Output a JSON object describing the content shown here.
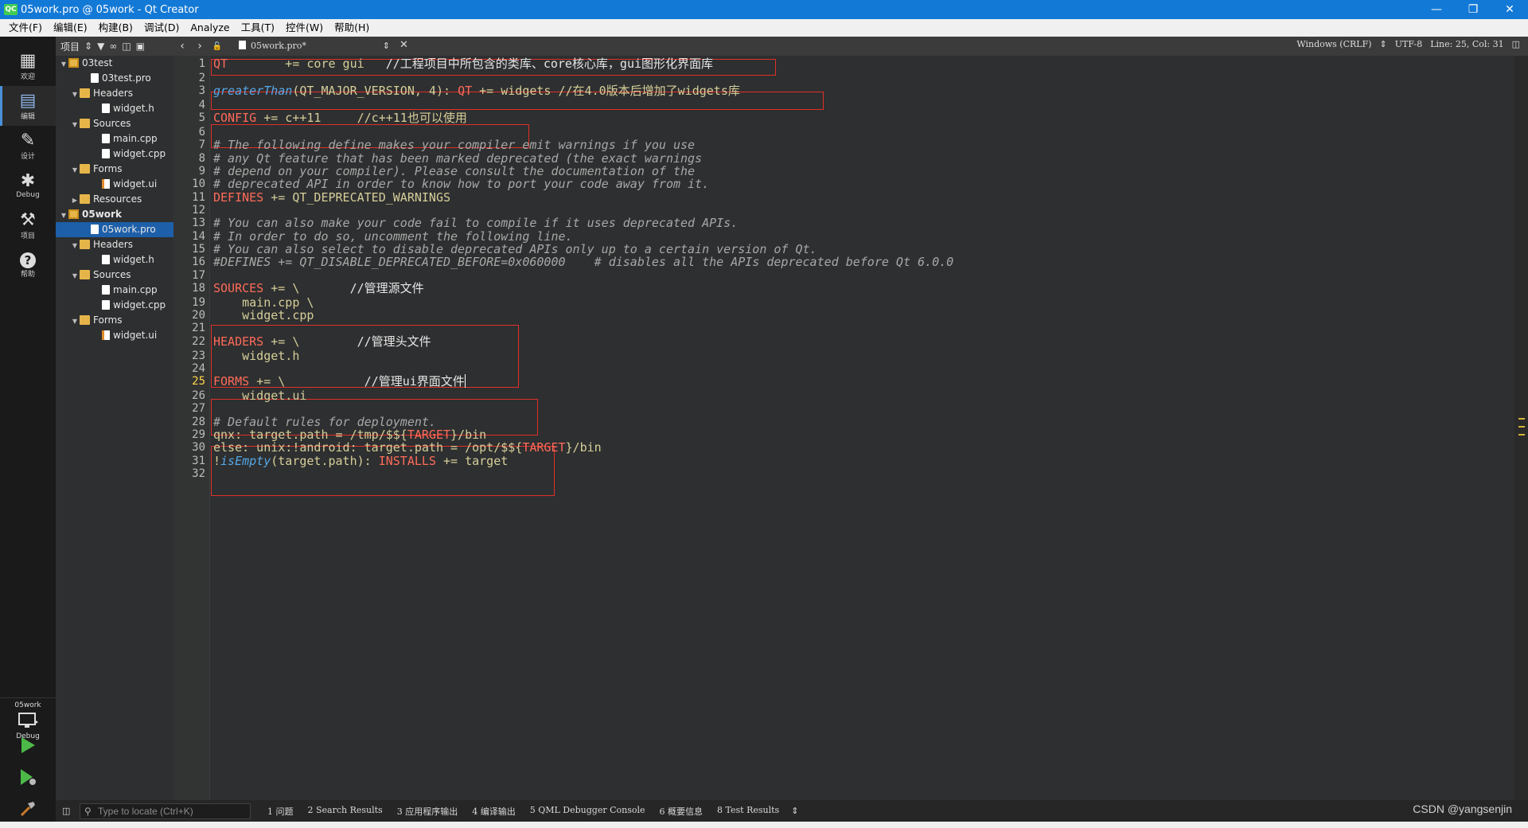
{
  "window": {
    "title": "05work.pro @ 05work - Qt Creator",
    "app_icon": "QC"
  },
  "menu": [
    "文件(F)",
    "编辑(E)",
    "构建(B)",
    "调试(D)",
    "Analyze",
    "工具(T)",
    "控件(W)",
    "帮助(H)"
  ],
  "modes": [
    {
      "label": "欢迎",
      "icon": "grid-icon"
    },
    {
      "label": "编辑",
      "icon": "edit-doc-icon"
    },
    {
      "label": "设计",
      "icon": "pencil-icon"
    },
    {
      "label": "Debug",
      "icon": "bug-icon"
    },
    {
      "label": "项目",
      "icon": "wrench-icon"
    },
    {
      "label": "帮助",
      "icon": "help-icon"
    }
  ],
  "kit": {
    "project": "05work",
    "config": "Debug"
  },
  "tree_toolbar": {
    "label": "项目"
  },
  "tree": [
    {
      "label": "03test",
      "type": "project",
      "depth": 0,
      "arrow": "▼"
    },
    {
      "label": "03test.pro",
      "type": "file",
      "depth": 2,
      "arrow": ""
    },
    {
      "label": "Headers",
      "type": "folder",
      "depth": 1,
      "arrow": "▼"
    },
    {
      "label": "widget.h",
      "type": "file",
      "depth": 3,
      "arrow": ""
    },
    {
      "label": "Sources",
      "type": "folder",
      "depth": 1,
      "arrow": "▼"
    },
    {
      "label": "main.cpp",
      "type": "file",
      "depth": 3,
      "arrow": ""
    },
    {
      "label": "widget.cpp",
      "type": "file",
      "depth": 3,
      "arrow": ""
    },
    {
      "label": "Forms",
      "type": "folder",
      "depth": 1,
      "arrow": "▼"
    },
    {
      "label": "widget.ui",
      "type": "form",
      "depth": 3,
      "arrow": ""
    },
    {
      "label": "Resources",
      "type": "folder",
      "depth": 1,
      "arrow": "▶"
    },
    {
      "label": "05work",
      "type": "project",
      "depth": 0,
      "arrow": "▼",
      "bold": true
    },
    {
      "label": "05work.pro",
      "type": "file",
      "depth": 2,
      "arrow": "",
      "selected": true
    },
    {
      "label": "Headers",
      "type": "folder",
      "depth": 1,
      "arrow": "▼"
    },
    {
      "label": "widget.h",
      "type": "file",
      "depth": 3,
      "arrow": ""
    },
    {
      "label": "Sources",
      "type": "folder",
      "depth": 1,
      "arrow": "▼"
    },
    {
      "label": "main.cpp",
      "type": "file",
      "depth": 3,
      "arrow": ""
    },
    {
      "label": "widget.cpp",
      "type": "file",
      "depth": 3,
      "arrow": ""
    },
    {
      "label": "Forms",
      "type": "folder",
      "depth": 1,
      "arrow": "▼"
    },
    {
      "label": "widget.ui",
      "type": "form",
      "depth": 3,
      "arrow": ""
    }
  ],
  "editor_toolbar": {
    "document": "05work.pro*",
    "line_ending": "Windows (CRLF)",
    "encoding": "UTF-8",
    "position": "Line: 25, Col: 31"
  },
  "current_line": 25,
  "code_lines": [
    [
      {
        "t": "QT",
        "s": "k"
      },
      {
        "t": "        += core gui   ",
        "s": "p"
      },
      {
        "t": "//工程项目中所包含的类库、core核心库，gui图形化界面库",
        "s": "w"
      }
    ],
    [],
    [
      {
        "t": "greaterThan",
        "s": "i"
      },
      {
        "t": "(QT_MAJOR_VERSION, 4): ",
        "s": "p"
      },
      {
        "t": "QT",
        "s": "k"
      },
      {
        "t": " += widgets //在4.0版本后增加了widgets库",
        "s": "p"
      }
    ],
    [],
    [
      {
        "t": "CONFIG",
        "s": "k"
      },
      {
        "t": " += c++11     //c++11也可以使用",
        "s": "p"
      }
    ],
    [],
    [
      {
        "t": "# The following define makes your compiler emit warnings if you use",
        "s": "c"
      }
    ],
    [
      {
        "t": "# any Qt feature that has been marked deprecated (the exact warnings",
        "s": "c"
      }
    ],
    [
      {
        "t": "# depend on your compiler). Please consult the documentation of the",
        "s": "c"
      }
    ],
    [
      {
        "t": "# deprecated API in order to know how to port your code away from it.",
        "s": "c"
      }
    ],
    [
      {
        "t": "DEFINES",
        "s": "k"
      },
      {
        "t": " += QT_DEPRECATED_WARNINGS",
        "s": "p"
      }
    ],
    [],
    [
      {
        "t": "# You can also make your code fail to compile if it uses deprecated APIs.",
        "s": "c"
      }
    ],
    [
      {
        "t": "# In order to do so, uncomment the following line.",
        "s": "c"
      }
    ],
    [
      {
        "t": "# You can also select to disable deprecated APIs only up to a certain version of Qt.",
        "s": "c"
      }
    ],
    [
      {
        "t": "#DEFINES += QT_DISABLE_DEPRECATED_BEFORE=0x060000    # disables all the APIs deprecated before Qt 6.0.0",
        "s": "c"
      }
    ],
    [],
    [
      {
        "t": "SOURCES",
        "s": "k"
      },
      {
        "t": " += \\       ",
        "s": "p"
      },
      {
        "t": "//管理源文件",
        "s": "w"
      }
    ],
    [
      {
        "t": "    main.cpp \\",
        "s": "p"
      }
    ],
    [
      {
        "t": "    widget.cpp",
        "s": "p"
      }
    ],
    [],
    [
      {
        "t": "HEADERS",
        "s": "k"
      },
      {
        "t": " += \\        ",
        "s": "p"
      },
      {
        "t": "//管理头文件",
        "s": "w"
      }
    ],
    [
      {
        "t": "    widget.h",
        "s": "p"
      }
    ],
    [],
    [
      {
        "t": "FORMS",
        "s": "k"
      },
      {
        "t": " += \\           ",
        "s": "p"
      },
      {
        "t": "//管理ui界面文件",
        "s": "w"
      }
    ],
    [
      {
        "t": "    widget.ui",
        "s": "p"
      }
    ],
    [],
    [
      {
        "t": "# Default rules for deployment.",
        "s": "c"
      }
    ],
    [
      {
        "t": "qnx: target.path = /tmp/$${",
        "s": "p"
      },
      {
        "t": "TARGET",
        "s": "k"
      },
      {
        "t": "}/bin",
        "s": "p"
      }
    ],
    [
      {
        "t": "else: unix:!android: target.path = /opt/$${",
        "s": "p"
      },
      {
        "t": "TARGET",
        "s": "k"
      },
      {
        "t": "}/bin",
        "s": "p"
      }
    ],
    [
      {
        "t": "!",
        "s": "p"
      },
      {
        "t": "isEmpty",
        "s": "i"
      },
      {
        "t": "(target.path): ",
        "s": "p"
      },
      {
        "t": "INSTALLS",
        "s": "k"
      },
      {
        "t": " += target",
        "s": "p"
      }
    ],
    []
  ],
  "bottom": {
    "locator_placeholder": "Type to locate (Ctrl+K)",
    "panes": [
      "1 问题",
      "2 Search Results",
      "3 应用程序输出",
      "4 编译输出",
      "5 QML Debugger Console",
      "6 概要信息",
      "8 Test Results"
    ],
    "watermark": "CSDN @yangsenjin"
  }
}
